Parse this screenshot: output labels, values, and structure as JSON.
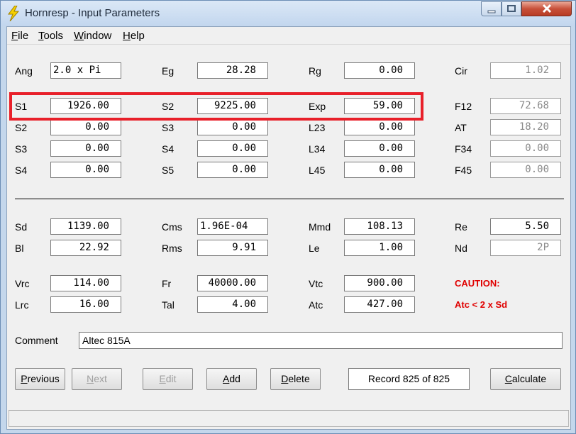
{
  "window": {
    "title": "Hornresp - Input Parameters"
  },
  "menu": [
    {
      "u": "F",
      "rest": "ile"
    },
    {
      "u": "T",
      "rest": "ools"
    },
    {
      "u": "W",
      "rest": "indow"
    },
    {
      "u": "H",
      "rest": "elp"
    }
  ],
  "params": {
    "ang": {
      "label": "Ang",
      "value": "2.0 x Pi"
    },
    "eg": {
      "label": "Eg",
      "value": "28.28"
    },
    "rg": {
      "label": "Rg",
      "value": "0.00"
    },
    "cir": {
      "label": "Cir",
      "value": "1.02"
    },
    "s1a": {
      "label": "S1",
      "value": "1926.00"
    },
    "s2a": {
      "label": "S2",
      "value": "9225.00"
    },
    "exp": {
      "label": "Exp",
      "value": "59.00"
    },
    "f12": {
      "label": "F12",
      "value": "72.68"
    },
    "s2b": {
      "label": "S2",
      "value": "0.00"
    },
    "s3a": {
      "label": "S3",
      "value": "0.00"
    },
    "l23": {
      "label": "L23",
      "value": "0.00"
    },
    "at": {
      "label": "AT",
      "value": "18.20"
    },
    "s3b": {
      "label": "S3",
      "value": "0.00"
    },
    "s4a": {
      "label": "S4",
      "value": "0.00"
    },
    "l34": {
      "label": "L34",
      "value": "0.00"
    },
    "f34": {
      "label": "F34",
      "value": "0.00"
    },
    "s4b": {
      "label": "S4",
      "value": "0.00"
    },
    "s5": {
      "label": "S5",
      "value": "0.00"
    },
    "l45": {
      "label": "L45",
      "value": "0.00"
    },
    "f45": {
      "label": "F45",
      "value": "0.00"
    },
    "sd": {
      "label": "Sd",
      "value": "1139.00"
    },
    "cms": {
      "label": "Cms",
      "value": "1.96E-04"
    },
    "mmd": {
      "label": "Mmd",
      "value": "108.13"
    },
    "re": {
      "label": "Re",
      "value": "5.50"
    },
    "bl": {
      "label": "Bl",
      "value": "22.92"
    },
    "rms": {
      "label": "Rms",
      "value": "9.91"
    },
    "le": {
      "label": "Le",
      "value": "1.00"
    },
    "nd": {
      "label": "Nd",
      "value": "2P"
    },
    "vrc": {
      "label": "Vrc",
      "value": "114.00"
    },
    "fr": {
      "label": "Fr",
      "value": "40000.00"
    },
    "vtc": {
      "label": "Vtc",
      "value": "900.00"
    },
    "lrc": {
      "label": "Lrc",
      "value": "16.00"
    },
    "tal": {
      "label": "Tal",
      "value": "4.00"
    },
    "atc": {
      "label": "Atc",
      "value": "427.00"
    }
  },
  "caution": {
    "title": "CAUTION:",
    "message": "Atc < 2 x Sd"
  },
  "comment": {
    "label": "Comment",
    "value": "Altec 815A"
  },
  "buttons": {
    "previous": {
      "u": "P",
      "rest": "revious"
    },
    "next": {
      "u": "N",
      "rest": "ext"
    },
    "edit": {
      "u": "E",
      "rest": "dit"
    },
    "add": {
      "u": "A",
      "rest": "dd"
    },
    "delete": {
      "u": "D",
      "rest": "elete"
    },
    "calculate": {
      "u": "C",
      "rest": "alculate"
    }
  },
  "record": "Record 825 of 825",
  "colors": {
    "highlight": "#e8202a",
    "caution": "#e00000"
  }
}
